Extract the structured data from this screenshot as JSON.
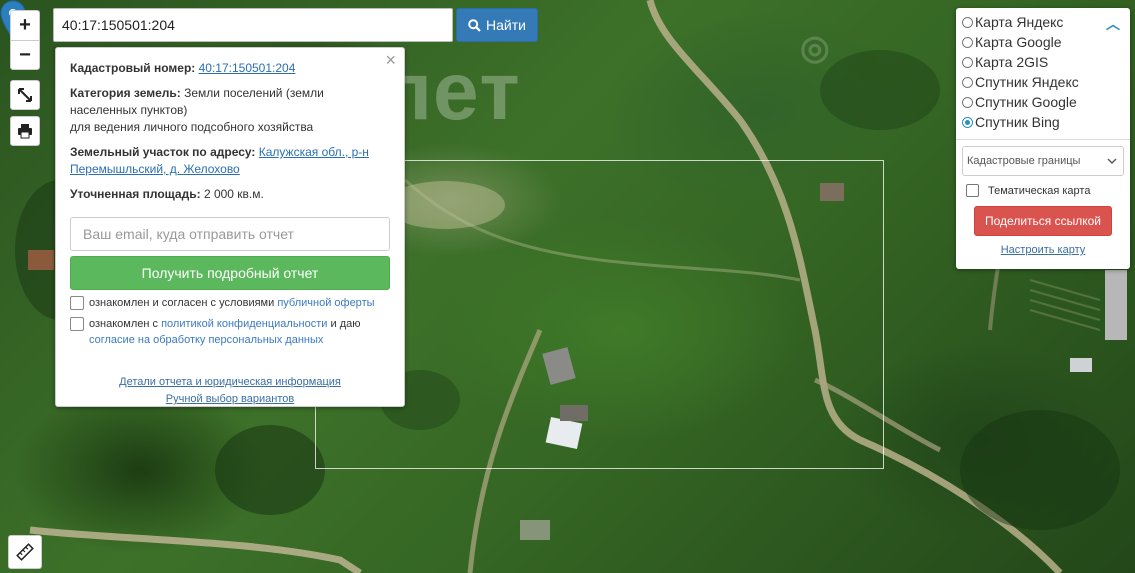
{
  "search": {
    "value": "40:17:150501:204",
    "button_label": "Найти"
  },
  "map": {
    "watermark_text": "лет"
  },
  "controls": {
    "zoom_in": "+",
    "zoom_out": "−"
  },
  "popup": {
    "close": "×",
    "cadastral_label": "Кадастровый номер:",
    "cadastral_value": "40:17:150501:204",
    "category_label": "Категория земель:",
    "category_value": "Земли поселений (земли населенных пунктов)",
    "usage_value": "для ведения личного подсобного хозяйства",
    "address_label": "Земельный участок по адресу:",
    "address_value": "Калужская обл., р-н Перемышльский, д. Желохово",
    "area_label": "Уточненная площадь:",
    "area_value": "2 000 кв.м.",
    "email_placeholder": "Ваш email, куда отправить отчет",
    "report_button": "Получить подробный отчет",
    "consent1_text": "ознакомлен и согласен с условиями",
    "consent1_link": "публичной оферты",
    "consent2_text_a": "ознакомлен с",
    "consent2_link_a": "политикой конфиденциальности",
    "consent2_text_b": "и даю",
    "consent2_link_b": "согласие на обработку персональных данных",
    "details_link": "Детали отчета и юридическая информация",
    "manual_link": "Ручной выбор вариантов"
  },
  "layers": {
    "items": [
      {
        "label": "Карта Яндекс",
        "selected": false
      },
      {
        "label": "Карта Google",
        "selected": false
      },
      {
        "label": "Карта 2GIS",
        "selected": false
      },
      {
        "label": "Спутник Яндекс",
        "selected": false
      },
      {
        "label": "Спутник Google",
        "selected": false
      },
      {
        "label": "Спутник Bing",
        "selected": true
      }
    ],
    "overlay_select": "Кадастровые границы",
    "thematic_label": "Тематическая карта",
    "share_button": "Поделиться ссылкой",
    "config_link": "Настроить карту"
  },
  "colors": {
    "search_button": "#337ab7",
    "report_button": "#5cb85c",
    "share_button": "#d9534f",
    "marker": "#2a7fc0"
  }
}
